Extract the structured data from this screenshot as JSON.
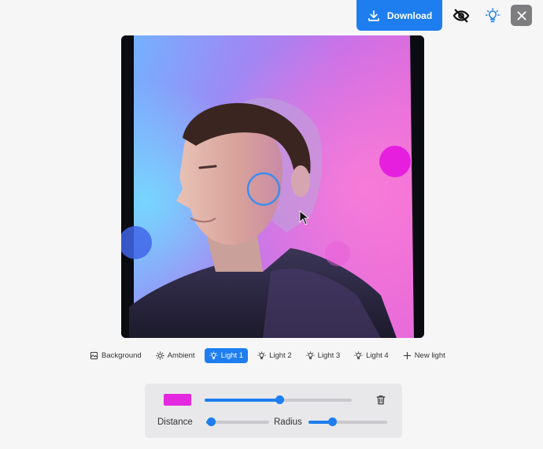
{
  "toolbar": {
    "download_label": "Download",
    "download_icon": "download-icon",
    "visibility_icon": "eye-off-icon",
    "light_icon": "lightbulb-icon",
    "close_icon": "close-icon",
    "accent_color": "#1e7ef0"
  },
  "canvas": {
    "content": "portrait photo with colored light effects",
    "selected_light_marker": "ring"
  },
  "tabs": [
    {
      "label": "Background",
      "icon": "image-icon",
      "active": false
    },
    {
      "label": "Ambient",
      "icon": "sun-icon",
      "active": false
    },
    {
      "label": "Light 1",
      "icon": "lightbulb-icon",
      "active": true
    },
    {
      "label": "Light 2",
      "icon": "lightbulb-icon",
      "active": false
    },
    {
      "label": "Light 3",
      "icon": "lightbulb-icon",
      "active": false
    },
    {
      "label": "Light 4",
      "icon": "lightbulb-icon",
      "active": false
    },
    {
      "label": "New light",
      "icon": "plus-icon",
      "active": false
    }
  ],
  "panel": {
    "light_color": "#e428e0",
    "intensity_value": 0.51,
    "distance_label": "Distance",
    "distance_value": 0.08,
    "radius_label": "Radius",
    "radius_value": 0.3,
    "delete_icon": "trash-icon"
  }
}
